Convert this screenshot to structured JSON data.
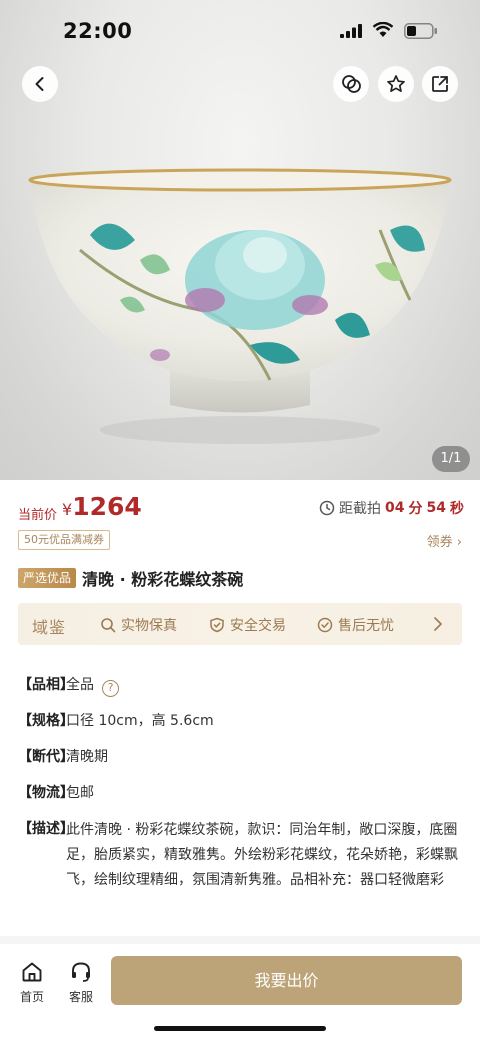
{
  "status_bar": {
    "time": "22:00"
  },
  "hero": {
    "image_counter": "1/1",
    "alt": "bowl-photo"
  },
  "price": {
    "label": "当前价",
    "currency": "¥",
    "value": "1264"
  },
  "countdown": {
    "label": "距截拍",
    "minutes": "04",
    "minutes_unit": "分",
    "seconds": "54",
    "seconds_unit": "秒"
  },
  "coupon": {
    "tag": "50元优品满减券",
    "action": "领券"
  },
  "title": {
    "badge": "严选优品",
    "text": "清晚 · 粉彩花蝶纹茶碗"
  },
  "guarantee": {
    "brand": "域鉴",
    "items": [
      "实物保真",
      "安全交易",
      "售后无忧"
    ]
  },
  "attributes": [
    {
      "key": "【品相】",
      "value": "全品"
    },
    {
      "key": "【规格】",
      "value": "口径 10cm，高 5.6cm"
    },
    {
      "key": "【断代】",
      "value": "清晚期"
    },
    {
      "key": "【物流】",
      "value": "包邮"
    },
    {
      "key": "【描述】",
      "value": "此件清晚 · 粉彩花蝶纹茶碗，款识：同治年制，敞口深腹，底圈足，胎质紧实，精致雅隽。外绘粉彩花蝶纹，花朵娇艳，彩蝶飘飞，绘制纹理精细，氛围清新隽雅。品相补充：器口轻微磨彩"
    }
  ],
  "bottom_bar": {
    "home_label": "首页",
    "service_label": "客服",
    "bid_label": "我要出价"
  },
  "colors": {
    "accent_red": "#b02a2a",
    "gold": "#a8865c",
    "button_gold": "#bda378"
  }
}
